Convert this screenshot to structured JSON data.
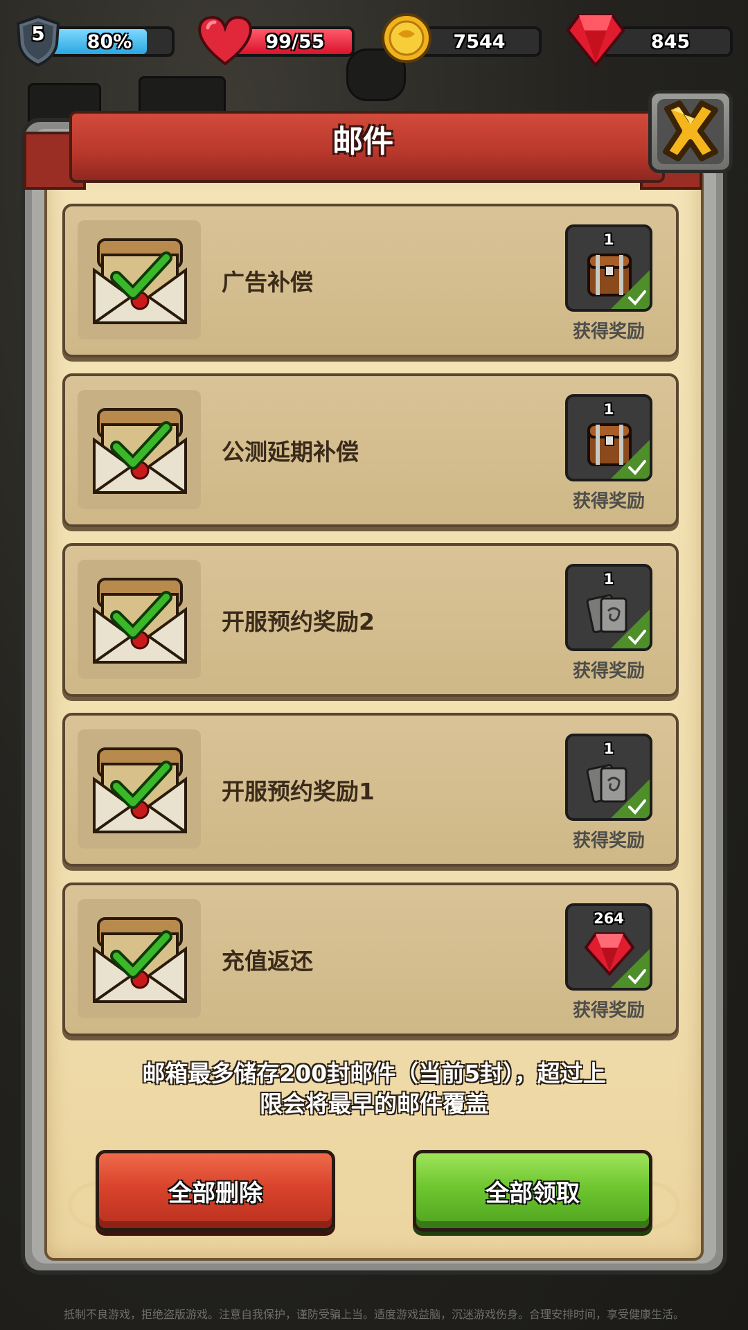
{
  "hud": {
    "level": "5",
    "xp_percent": "80%",
    "xp_progress": 0.8,
    "health": "99/55",
    "gold": "7544",
    "gems": "845"
  },
  "dialog": {
    "title": "邮件",
    "close_icon": "close-x-icon"
  },
  "mails": [
    {
      "title": "广告补偿",
      "reward_count": "1",
      "reward_icon": "treasure-chest-icon",
      "status": "获得奖励"
    },
    {
      "title": "公测延期补偿",
      "reward_count": "1",
      "reward_icon": "treasure-chest-icon",
      "status": "获得奖励"
    },
    {
      "title": "开服预约奖励2",
      "reward_count": "1",
      "reward_icon": "card-icon",
      "status": "获得奖励"
    },
    {
      "title": "开服预约奖励1",
      "reward_count": "1",
      "reward_icon": "card-icon",
      "status": "获得奖励"
    },
    {
      "title": "充值返还",
      "reward_count": "264",
      "reward_icon": "ruby-gem-icon",
      "status": "获得奖励"
    }
  ],
  "note": {
    "line1": "邮箱最多储存200封邮件（当前5封），超过上",
    "line2": "限会将最早的邮件覆盖"
  },
  "buttons": {
    "delete_all": "全部删除",
    "claim_all": "全部领取"
  },
  "footer": {
    "disclaimer": "抵制不良游戏，拒绝盗版游戏。注意自我保护，谨防受骗上当。适度游戏益脑，沉迷游戏伤身。合理安排时间，享受健康生活。"
  },
  "colors": {
    "xp_fill": "#36b8ee",
    "health_fill": "#e8243a",
    "ribbon": "#c4402f",
    "delete_button": "#d9432c",
    "claim_button": "#6ec630"
  }
}
